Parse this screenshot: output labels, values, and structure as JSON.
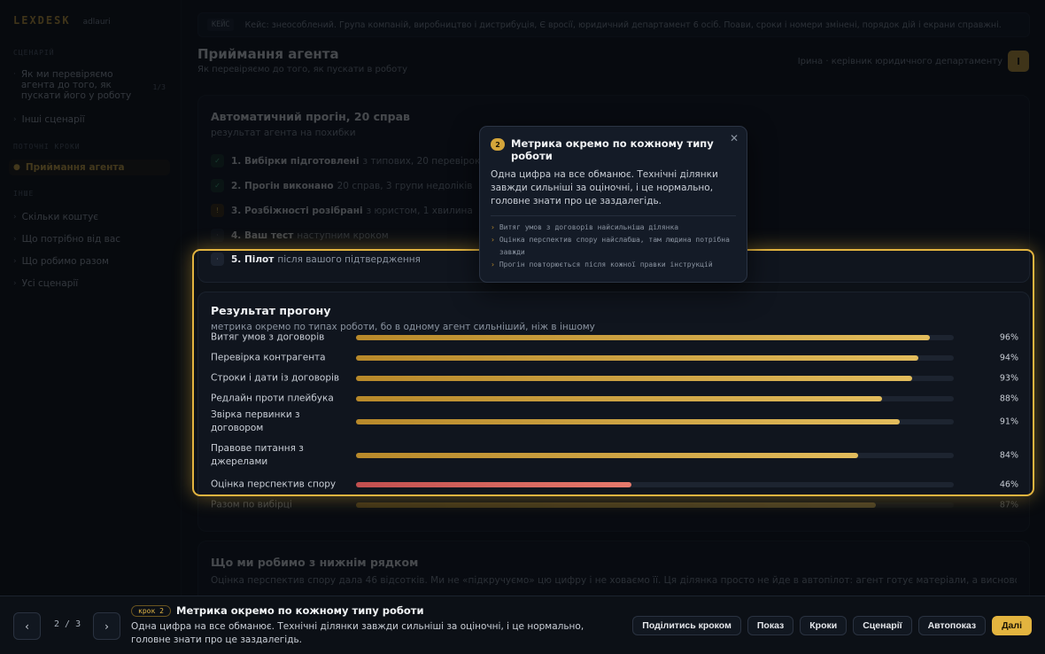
{
  "brand": {
    "name": "LEXDESK",
    "sub": "adlauri"
  },
  "sidebar": {
    "section_scenario": "Сценарій",
    "scenario_item": {
      "label": "Як ми перевіряємо агента до того, як пускати його у роботу",
      "count": "1/3"
    },
    "other_scenarios": "Інші сценарії",
    "section_tour": "Поточні кроки",
    "active_item": "Приймання агента",
    "section_more": "Інше",
    "items": [
      "Скільки коштує",
      "Що потрібно від вас",
      "Що робимо разом",
      "Усі сценарії"
    ]
  },
  "banner": {
    "tag": "КЕЙС",
    "text": "Кейс: знеособлений. Група компаній, виробництво і дистрибуція, Є вросії, юридичний департамент 6 осіб. Поави, сроки і номери змінені, порядок дій і екрани справжні."
  },
  "header": {
    "title": "Приймання агента",
    "subtitle": "Як перевіряємо до того, як пускати в роботу",
    "right_link": "Ірина · керівник юридичного департаменту",
    "right_button": "І"
  },
  "auto_card": {
    "title": "Автоматичний прогін, 20 справ",
    "subtitle": "результат агента на похибки",
    "steps": [
      {
        "label": "1. Вибірки підготовлені",
        "detail": "з типових, 20 перевірок"
      },
      {
        "label": "2. Прогін виконано",
        "detail": "20 справ, 3 групи недоліків"
      },
      {
        "label": "3. Розбіжності розібрані",
        "detail": "з юристом, 1 хвилина"
      },
      {
        "label": "4. Ваш тест",
        "detail": "наступним кроком"
      },
      {
        "label": "5. Пілот",
        "detail": "після вашого підтвердження"
      }
    ]
  },
  "result_card": {
    "title": "Результат прогону",
    "subtitle": "метрика окремо по типах роботи, бо в одному агент сильніший, ніж в іншому"
  },
  "chart_data": {
    "type": "bar",
    "orientation": "horizontal",
    "categories": [
      "Витяг умов з договорів",
      "Перевірка контрагента",
      "Строки і дати із договорів",
      "Редлайн проти плейбука",
      "Звірка первинки з договором",
      "Правове питання з джерелами",
      "Оцінка перспектив спору",
      "Разом по вибірці"
    ],
    "values": [
      96,
      94,
      93,
      88,
      91,
      84,
      46,
      87
    ],
    "value_labels": [
      "96%",
      "94%",
      "93%",
      "88%",
      "91%",
      "84%",
      "46%",
      "87%"
    ],
    "xlim": [
      0,
      100
    ],
    "highlight_color": "#e3b43f",
    "low_color": "#e0625a"
  },
  "bottom_card": {
    "title": "Що ми робимо з нижнім рядком",
    "text": "Оцінка перспектив спору дала 46 відсотків. Ми не «підкручуємо» цю цифру і не ховаємо її. Ця ділянка просто не йде в автопілот: агент готує матеріали, а висновок робить юрист."
  },
  "popover": {
    "step": "2",
    "title": "Метрика окремо по кожному типу роботи",
    "body": "Одна цифра на все обманює. Технічні ділянки завжди сильніші за оціночні, і це нормально, головне знати про це заздалегідь.",
    "notes": [
      "Витяг умов з договорів найсильніша ділянка",
      "Оцінка перспектив спору найслабша, там людина потрібна завжди",
      "Прогін повторюється після кожної правки інструкцій"
    ]
  },
  "tourbar": {
    "pager": "2 / 3",
    "step_badge": "крок 2",
    "title": "Метрика окремо по кожному типу роботи",
    "description": "Одна цифра на все обманює. Технічні ділянки завжди сильніші за оціночні, і це нормально, головне знати про це заздалегідь.",
    "buttons": {
      "share": "Поділитись кроком",
      "show": "Показ",
      "steps": "Кроки",
      "scenarios": "Сценарії",
      "autoplay": "Автопоказ",
      "next": "Далі"
    }
  },
  "colors": {
    "accent": "#e3b43f",
    "background": "#0d1117",
    "panel": "#10151e"
  }
}
